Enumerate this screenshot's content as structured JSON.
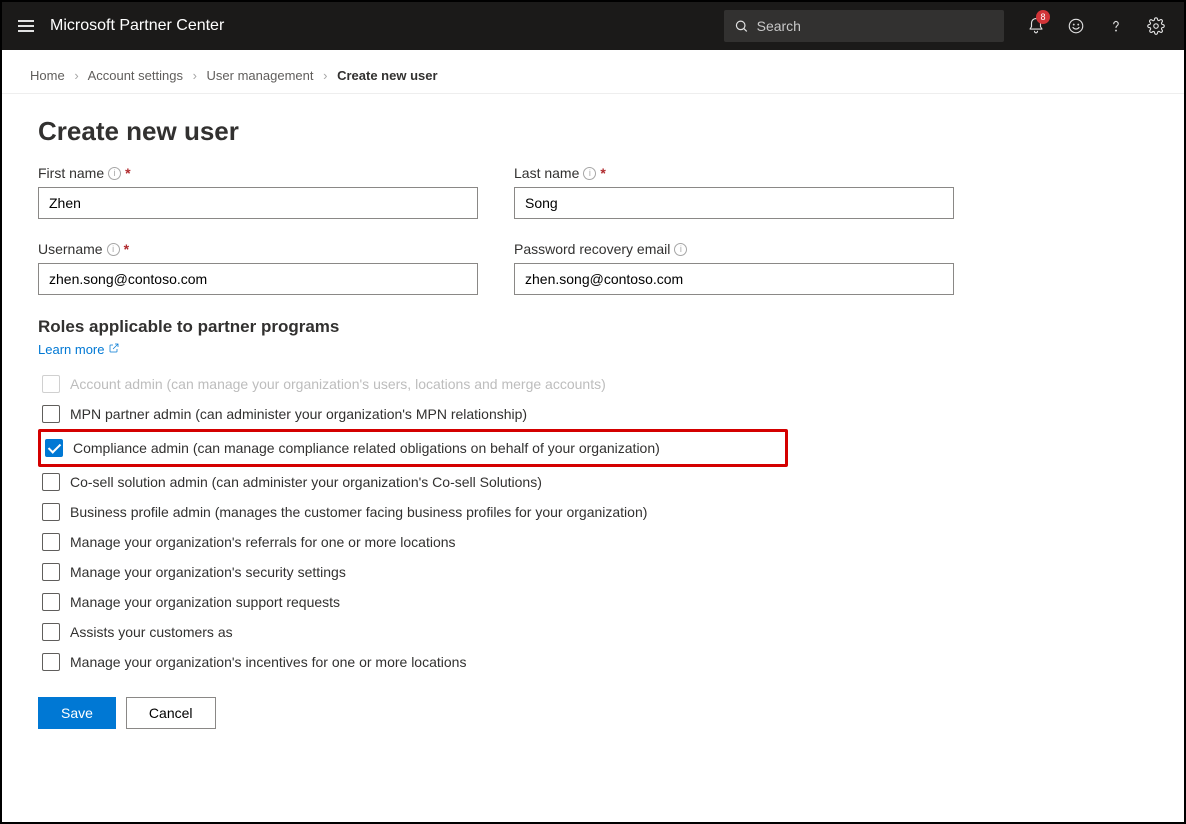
{
  "header": {
    "app_title": "Microsoft Partner Center",
    "search_placeholder": "Search",
    "notification_count": "8"
  },
  "breadcrumb": {
    "items": [
      {
        "label": "Home"
      },
      {
        "label": "Account settings"
      },
      {
        "label": "User management"
      },
      {
        "label": "Create new user",
        "current": true
      }
    ]
  },
  "page": {
    "title": "Create new user",
    "fields": {
      "first_name": {
        "label": "First name",
        "value": "Zhen",
        "required": true,
        "info": true
      },
      "last_name": {
        "label": "Last name",
        "value": "Song",
        "required": true,
        "info": true
      },
      "username": {
        "label": "Username",
        "value": "zhen.song@contoso.com",
        "required": true,
        "info": true
      },
      "recovery": {
        "label": "Password recovery email",
        "value": "zhen.song@contoso.com",
        "required": false,
        "info": true
      }
    },
    "roles_section_title": "Roles applicable to partner programs",
    "learn_more": "Learn more",
    "roles": [
      {
        "label": "Account admin (can manage your organization's users, locations and merge accounts)",
        "checked": false,
        "faded": true
      },
      {
        "label": "MPN partner admin (can administer your organization's MPN relationship)",
        "checked": false
      },
      {
        "label": "Compliance admin (can manage compliance related obligations on behalf of your organization)",
        "checked": true,
        "highlight": true
      },
      {
        "label": "Co-sell solution admin (can administer your organization's Co-sell Solutions)",
        "checked": false
      },
      {
        "label": "Business profile admin (manages the customer facing business profiles for your organization)",
        "checked": false
      },
      {
        "label": "Manage your organization's referrals for one or more locations",
        "checked": false
      },
      {
        "label": "Manage your organization's security settings",
        "checked": false
      },
      {
        "label": "Manage your organization support requests",
        "checked": false
      },
      {
        "label": "Assists your customers as",
        "checked": false
      },
      {
        "label": "Manage your organization's incentives for one or more locations",
        "checked": false
      }
    ],
    "actions": {
      "save": "Save",
      "cancel": "Cancel"
    }
  }
}
